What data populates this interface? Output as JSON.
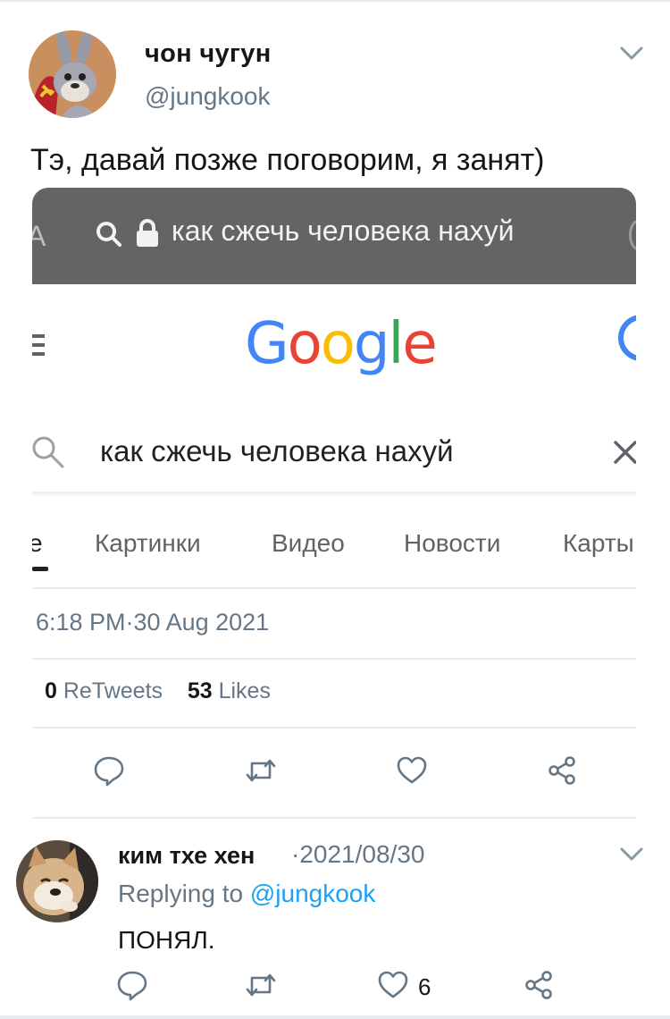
{
  "tweet": {
    "author_name": "чон чугун",
    "author_handle": "@jungkook",
    "text": "Тэ, давай позже поговорим, я занят)",
    "timestamp": "6:18 PM·30 Aug 2021",
    "retweets_count": "0",
    "retweets_label": "ReTweets",
    "likes_count": "53",
    "likes_label": "Likes"
  },
  "screenshot": {
    "url_left_fragment": "A",
    "url_text": "как сжечь человека нахуй",
    "google_logo": [
      "G",
      "o",
      "o",
      "g",
      "l",
      "e"
    ],
    "google_colors": [
      "#4285f4",
      "#ea4335",
      "#fbbc05",
      "#4285f4",
      "#34a853",
      "#ea4335"
    ],
    "search_query": "как сжечь человека нахуй",
    "tabs": [
      "е",
      "Картинки",
      "Видео",
      "Новости",
      "Карты"
    ]
  },
  "reply": {
    "author_name": "ким тхе хен",
    "date": "·2021/08/30",
    "replying_prefix": "Replying to",
    "replying_handle": "@jungkook",
    "text": "ПОНЯЛ.",
    "like_count": "6"
  },
  "colors": {
    "secondary_text": "#657786",
    "link": "#1da1f2",
    "divider": "#e6ecf0"
  },
  "icons": [
    "chevron-down-icon",
    "reply-icon",
    "retweet-icon",
    "like-icon",
    "share-icon",
    "search-icon",
    "lock-icon",
    "menu-icon",
    "close-icon",
    "account-icon"
  ]
}
